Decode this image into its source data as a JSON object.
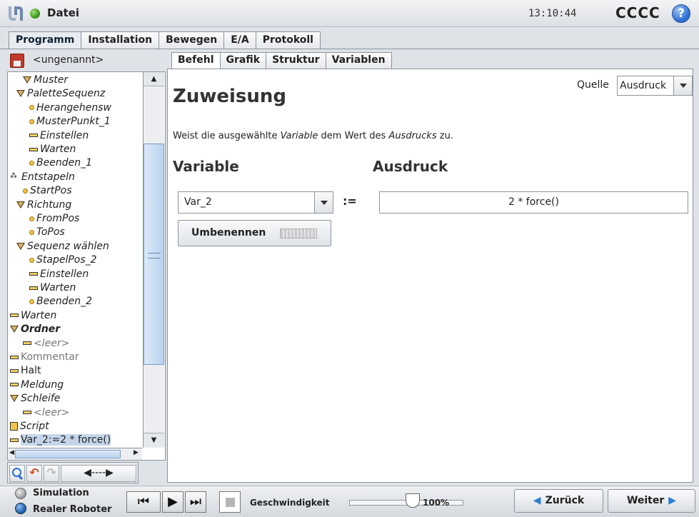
{
  "header": {
    "file_label": "Datei",
    "time": "13:10:44",
    "robot_name": "CCCC",
    "help": "?"
  },
  "main_tabs": [
    {
      "label": "Programm",
      "active": true
    },
    {
      "label": "Installation",
      "active": false
    },
    {
      "label": "Bewegen",
      "active": false
    },
    {
      "label": "E/A",
      "active": false
    },
    {
      "label": "Protokoll",
      "active": false
    }
  ],
  "program": {
    "name": "<ungenannt>"
  },
  "tree": [
    {
      "label": "Muster",
      "icon": "triangle",
      "indent": 2,
      "style": "italic"
    },
    {
      "label": "PaletteSequenz",
      "icon": "triangle",
      "indent": 1,
      "style": "italic"
    },
    {
      "label": "Herangehensw",
      "icon": "dot",
      "indent": 3,
      "style": "italic"
    },
    {
      "label": "MusterPunkt_1",
      "icon": "dot",
      "indent": 3,
      "style": "italic"
    },
    {
      "label": "Einstellen",
      "icon": "bar",
      "indent": 3,
      "style": "italic"
    },
    {
      "label": "Warten",
      "icon": "bar",
      "indent": 3,
      "style": "italic"
    },
    {
      "label": "Beenden_1",
      "icon": "dot",
      "indent": 3,
      "style": "italic"
    },
    {
      "label": "Entstapeln",
      "icon": "net",
      "indent": 0,
      "style": "italic"
    },
    {
      "label": "StartPos",
      "icon": "dot",
      "indent": 2,
      "style": "italic"
    },
    {
      "label": "Richtung",
      "icon": "triangle",
      "indent": 1,
      "style": "italic"
    },
    {
      "label": "FromPos",
      "icon": "dot",
      "indent": 3,
      "style": "italic"
    },
    {
      "label": "ToPos",
      "icon": "dot",
      "indent": 3,
      "style": "italic"
    },
    {
      "label": "Sequenz wählen",
      "icon": "triangle",
      "indent": 1,
      "style": "italic"
    },
    {
      "label": "StapelPos_2",
      "icon": "dot",
      "indent": 3,
      "style": "italic"
    },
    {
      "label": "Einstellen",
      "icon": "bar",
      "indent": 3,
      "style": "italic"
    },
    {
      "label": "Warten",
      "icon": "bar",
      "indent": 3,
      "style": "italic"
    },
    {
      "label": "Beenden_2",
      "icon": "dot",
      "indent": 3,
      "style": "italic"
    },
    {
      "label": "Warten",
      "icon": "bar",
      "indent": 0,
      "style": "italic"
    },
    {
      "label": "Ordner",
      "icon": "triangle",
      "indent": 0,
      "style": "bold"
    },
    {
      "label": "<leer>",
      "icon": "bar",
      "indent": 2,
      "style": "grey-italic"
    },
    {
      "label": "Kommentar",
      "icon": "bar",
      "indent": 0,
      "style": "grey"
    },
    {
      "label": "Halt",
      "icon": "bar",
      "indent": 0,
      "style": "normal"
    },
    {
      "label": "Meldung",
      "icon": "bar",
      "indent": 0,
      "style": "italic"
    },
    {
      "label": "Schleife",
      "icon": "triangle",
      "indent": 0,
      "style": "italic"
    },
    {
      "label": "<leer>",
      "icon": "bar",
      "indent": 2,
      "style": "grey-italic"
    },
    {
      "label": "Script",
      "icon": "script",
      "indent": 0,
      "style": "italic"
    },
    {
      "label": "Var_2:=2 * force()",
      "icon": "bar",
      "indent": 0,
      "style": "selected"
    }
  ],
  "tree_toolbar": {
    "move_label": "◀----▶"
  },
  "content_tabs": [
    {
      "label": "Befehl",
      "active": true
    },
    {
      "label": "Grafik",
      "active": false
    },
    {
      "label": "Struktur",
      "active": false
    },
    {
      "label": "Variablen",
      "active": false
    }
  ],
  "command": {
    "title": "Zuweisung",
    "source_label": "Quelle",
    "source_value": "Ausdruck",
    "description_parts": [
      "Weist die ausgewählte ",
      "Variable",
      " dem Wert des ",
      "Ausdrucks",
      " zu."
    ],
    "variable_heading": "Variable",
    "expression_heading": "Ausdruck",
    "variable_value": "Var_2",
    "assign_operator": ":=",
    "expression_value": "2 * force()",
    "rename_label": "Umbenennen"
  },
  "footer": {
    "simulation_label": "Simulation",
    "real_robot_label": "Realer Roboter",
    "speed_label": "Geschwindigkeit",
    "speed_value": "100%",
    "speed_fraction": 1.0,
    "back_label": "Zurück",
    "next_label": "Weiter"
  }
}
